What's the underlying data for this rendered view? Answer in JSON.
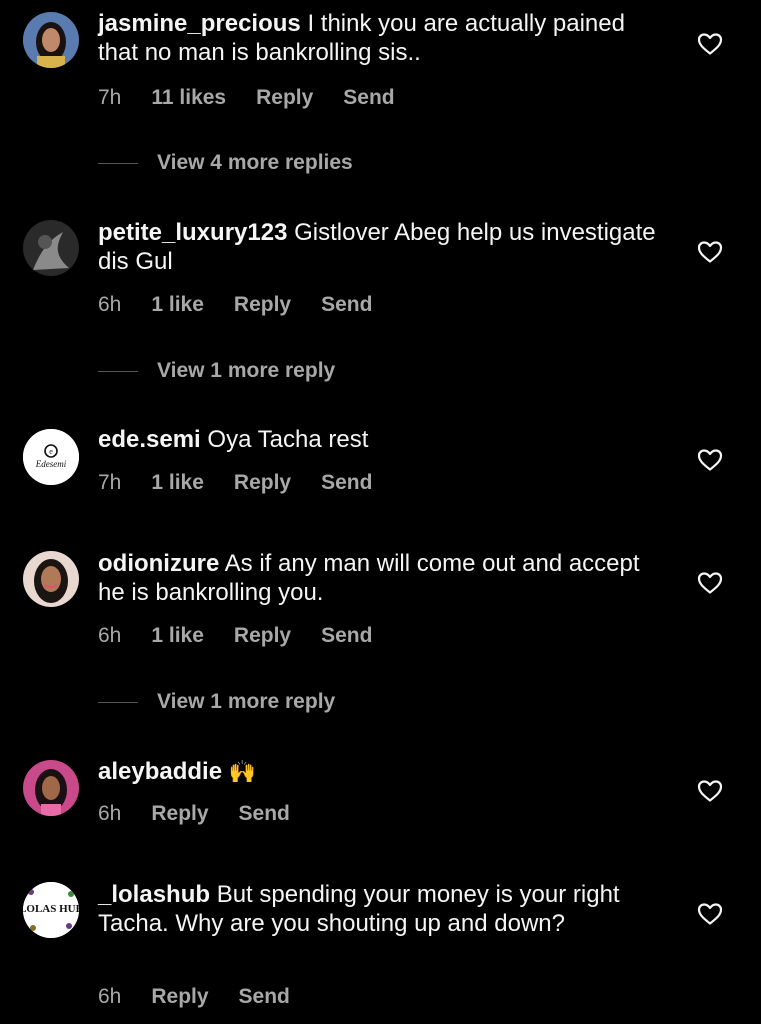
{
  "comments": [
    {
      "username": "jasmine_precious",
      "text": "I think you are actually pained that no man is bankrolling sis..",
      "time": "7h",
      "likes": "11 likes",
      "reply": "Reply",
      "send": "Send"
    },
    {
      "username": "petite_luxury123",
      "text": "Gistlover Abeg help us investigate dis Gul",
      "time": "6h",
      "likes": "1 like",
      "reply": "Reply",
      "send": "Send"
    },
    {
      "username": "ede.semi",
      "text": "Oya Tacha rest",
      "time": "7h",
      "likes": "1 like",
      "reply": "Reply",
      "send": "Send",
      "avatar_text": "Edesemi"
    },
    {
      "username": "odionizure",
      "text": "As if any man will come out and accept he is bankrolling you.",
      "time": "6h",
      "likes": "1 like",
      "reply": "Reply",
      "send": "Send"
    },
    {
      "username": "aleybaddie",
      "text": "🙌",
      "time": "6h",
      "reply": "Reply",
      "send": "Send"
    },
    {
      "username": "_lolashub",
      "text": "But spending your money is your right Tacha. Why are you shouting up and down?",
      "time": "6h",
      "reply": "Reply",
      "send": "Send",
      "avatar_text": "LOLAS HUB"
    }
  ],
  "view_more": {
    "first": "View 4 more replies",
    "second": "View 1 more reply",
    "third": "View 1 more reply"
  },
  "icons": {
    "heart": "heart-outline-icon"
  },
  "colors": {
    "background": "#000000",
    "text": "#f5f5f5",
    "muted": "#a8a8a8"
  }
}
